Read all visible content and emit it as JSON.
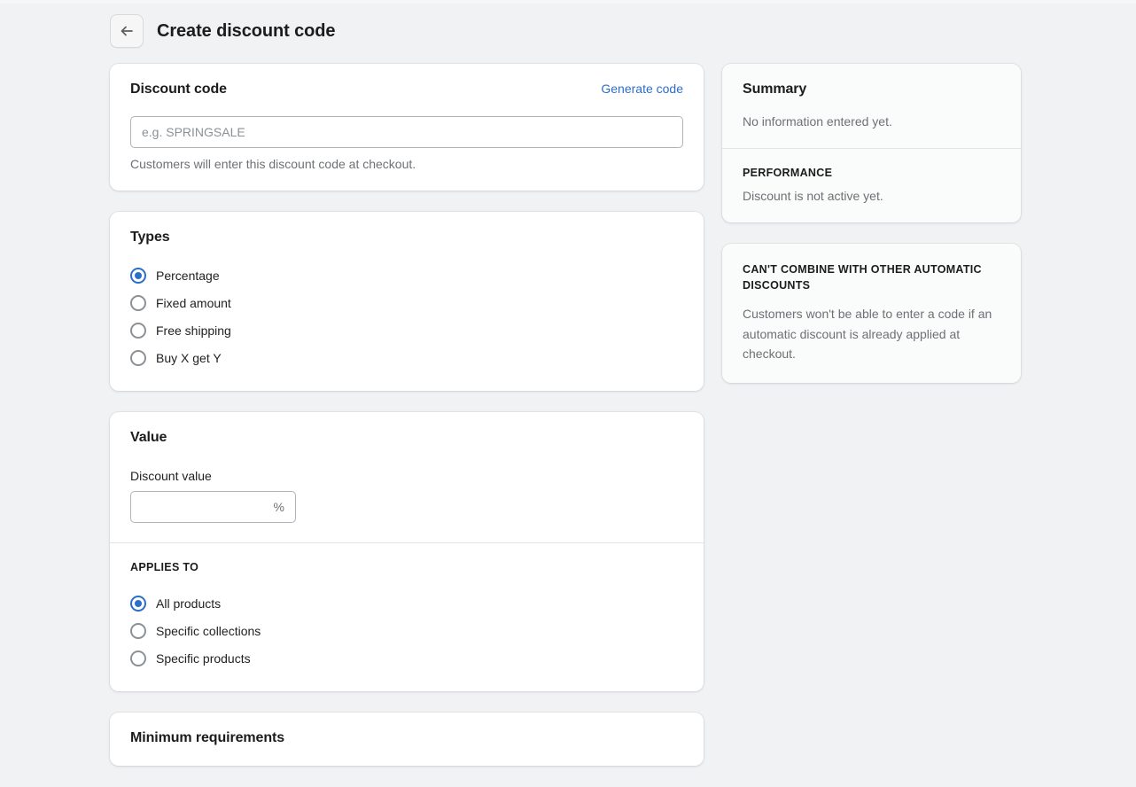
{
  "header": {
    "title": "Create discount code",
    "back_icon": "arrow-left-icon"
  },
  "discount_code_card": {
    "title": "Discount code",
    "generate_label": "Generate code",
    "input_value": "",
    "input_placeholder": "e.g. SPRINGSALE",
    "help_text": "Customers will enter this discount code at checkout."
  },
  "types_card": {
    "title": "Types",
    "options": [
      {
        "label": "Percentage",
        "selected": true
      },
      {
        "label": "Fixed amount",
        "selected": false
      },
      {
        "label": "Free shipping",
        "selected": false
      },
      {
        "label": "Buy X get Y",
        "selected": false
      }
    ]
  },
  "value_card": {
    "title": "Value",
    "field_label": "Discount value",
    "input_value": "",
    "suffix": "%",
    "applies_to": {
      "heading": "APPLIES TO",
      "options": [
        {
          "label": "All products",
          "selected": true
        },
        {
          "label": "Specific collections",
          "selected": false
        },
        {
          "label": "Specific products",
          "selected": false
        }
      ]
    }
  },
  "minimum_requirements_card": {
    "title": "Minimum requirements"
  },
  "summary_card": {
    "title": "Summary",
    "empty_text": "No information entered yet.",
    "performance_heading": "PERFORMANCE",
    "performance_text": "Discount is not active yet."
  },
  "combine_note_card": {
    "heading": "CAN'T COMBINE WITH OTHER AUTOMATIC DISCOUNTS",
    "body": "Customers won't be able to enter a code if an automatic discount is already applied at checkout."
  },
  "colors": {
    "accent": "#2c6ecb",
    "page_bg": "#f1f2f4",
    "card_bg": "#ffffff",
    "muted_card_bg": "#fafbfb",
    "text": "#202223",
    "subdued_text": "#6d7175"
  }
}
